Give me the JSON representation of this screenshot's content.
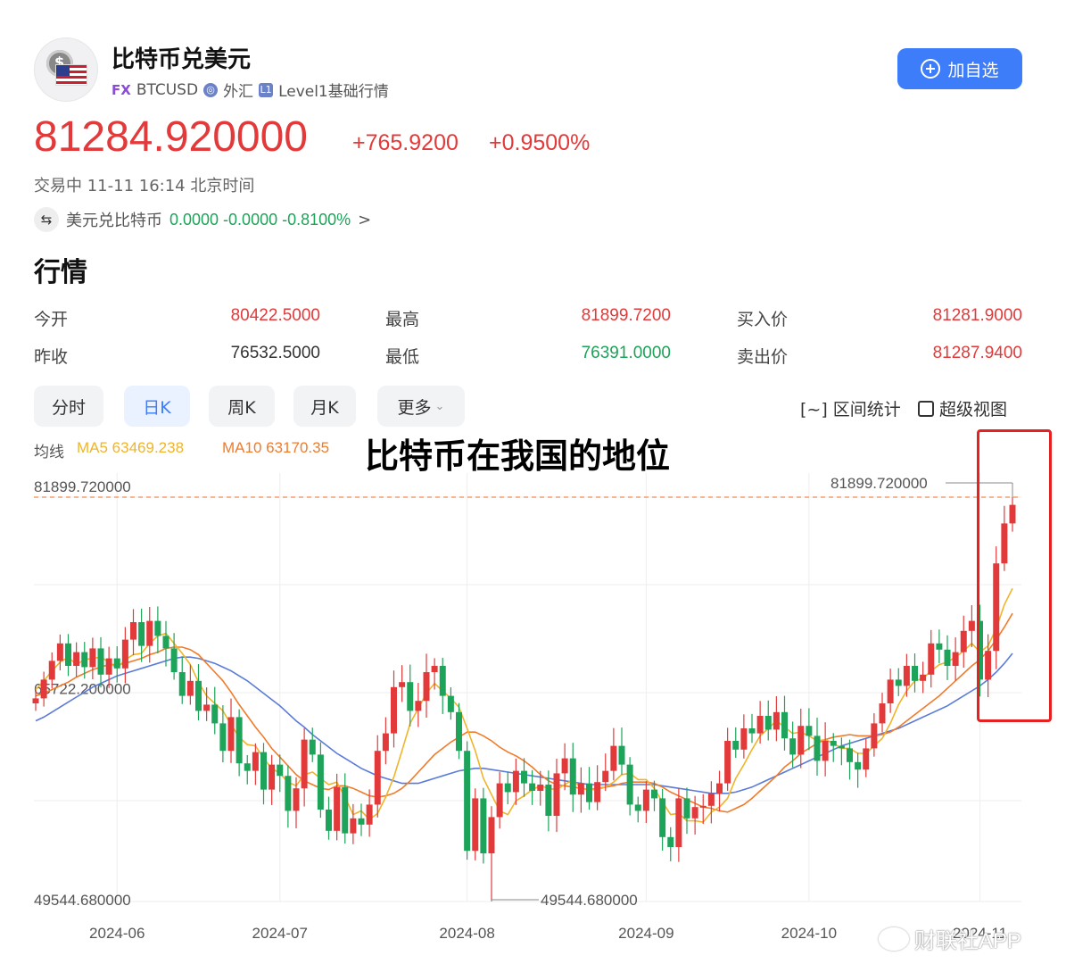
{
  "header": {
    "title": "比特币兑美元",
    "fx_badge": "FX",
    "symbol": "BTCUSD",
    "market": "外汇",
    "level_badge": "L1",
    "level": "Level1基础行情",
    "add_button": "加自选"
  },
  "quote": {
    "price": "81284.920000",
    "change": "+765.9200",
    "change_pct": "+0.9500%",
    "status": "交易中 11-11 16:14 北京时间",
    "inverse_label": "美元兑比特币",
    "inverse_values": "0.0000 -0.0000 -0.8100%",
    "inverse_arrow": ">"
  },
  "section_title": "行情",
  "stats": {
    "open_label": "今开",
    "open": "80422.5000",
    "prev_close_label": "昨收",
    "prev_close": "76532.5000",
    "high_label": "最高",
    "high": "81899.7200",
    "low_label": "最低",
    "low": "76391.0000",
    "bid_label": "买入价",
    "bid": "81281.9000",
    "ask_label": "卖出价",
    "ask": "81287.9400"
  },
  "tabs": [
    "分时",
    "日K",
    "周K",
    "月K",
    "更多"
  ],
  "tools": {
    "range": "[~] 区间统计",
    "super": "超级视图"
  },
  "ma": {
    "label": "均线",
    "ma5": "MA5 63469.238",
    "ma10": "MA10 63170.35"
  },
  "overlay_title": "比特币在我国的地位",
  "watermark": "财联社APP",
  "colors": {
    "up": "#e23a3a",
    "down": "#1ea35a",
    "ma5": "#f0b429",
    "ma10": "#f07b2a",
    "ma20": "#5b7bd9",
    "accent": "#3d7dfa"
  },
  "chart_data": {
    "type": "candlestick",
    "y_labels": [
      "81899.720000",
      "65722.200000",
      "49544.680000"
    ],
    "annotations": {
      "high": "81899.720000",
      "low": "49544.680000"
    },
    "ylim": [
      49544.68,
      81899.72
    ],
    "x_ticks": [
      "2024-06",
      "2024-07",
      "2024-08",
      "2024-09",
      "2024-10",
      "2024-11"
    ],
    "x_tick_index": [
      10,
      30,
      53,
      75,
      95,
      116
    ],
    "close": [
      65800,
      67300,
      68800,
      70200,
      68400,
      69500,
      68300,
      69800,
      67700,
      69000,
      68200,
      70500,
      71900,
      70000,
      72000,
      70800,
      69800,
      67900,
      66000,
      67200,
      64800,
      65300,
      63800,
      61600,
      64300,
      60600,
      60000,
      61500,
      58500,
      60500,
      59600,
      56800,
      58600,
      62500,
      61300,
      56900,
      55200,
      58700,
      55000,
      56200,
      55700,
      57300,
      61600,
      63000,
      66700,
      67100,
      64800,
      65600,
      67900,
      68400,
      66000,
      64700,
      61600,
      53600,
      57800,
      53400,
      56300,
      59000,
      58300,
      60000,
      59000,
      58400,
      58900,
      56400,
      59800,
      61000,
      58100,
      59000,
      57500,
      59100,
      60000,
      62000,
      60500,
      57300,
      56800,
      58500,
      57800,
      54700,
      53900,
      57800,
      56200,
      57100,
      57200,
      58200,
      59000,
      62400,
      61700,
      63400,
      63000,
      64400,
      63300,
      64700,
      62600,
      61300,
      63600,
      62800,
      60800,
      62400,
      62000,
      61800,
      60700,
      60100,
      61800,
      63800,
      65400,
      67300,
      66800,
      68400,
      67200,
      67700,
      70200,
      69700,
      68400,
      69500,
      71200,
      72000,
      67300,
      69600,
      76600,
      79800,
      81285
    ],
    "ma5": [
      66500,
      67200,
      68000,
      68700,
      69100,
      68500,
      68900,
      69000,
      69100,
      68700,
      68200,
      68900,
      69300,
      69400,
      70200,
      70800,
      71000,
      70200,
      69400,
      68500,
      67100,
      66000,
      65400,
      64800,
      63700,
      62700,
      62100,
      62000,
      61000,
      60200,
      59800,
      59100,
      58800,
      59700,
      59900,
      59400,
      58900,
      59100,
      57900,
      56500,
      56800,
      56100,
      56600,
      57900,
      59500,
      61600,
      63800,
      65000,
      66200,
      67000,
      66400,
      65800,
      65100,
      63400,
      61600,
      59400,
      58100,
      56800,
      56500,
      57600,
      58000,
      58500,
      58800,
      58600,
      58500,
      58900,
      59300,
      58600,
      58500,
      58500,
      58700,
      59100,
      59700,
      59800,
      59300,
      59300,
      58600,
      57500,
      56500,
      56600,
      56000,
      56000,
      55900,
      56700,
      57100,
      57800,
      59400,
      60500,
      61700,
      62800,
      63400,
      64000,
      63500,
      63000,
      63100,
      62800,
      62400,
      62500,
      62200,
      61800,
      61800,
      61400,
      61400,
      62000,
      62600,
      63800,
      65300,
      66400,
      67200,
      67400,
      68000,
      68500,
      68700,
      69100,
      69600,
      70200,
      69500,
      70000,
      71400,
      73300,
      74600
    ],
    "ma10": [
      66000,
      66200,
      66500,
      66800,
      67100,
      67500,
      67800,
      68100,
      68300,
      68500,
      68500,
      68600,
      68800,
      69000,
      69300,
      69500,
      69800,
      69900,
      69900,
      69700,
      69300,
      68600,
      67900,
      67200,
      66300,
      65300,
      64400,
      63500,
      62700,
      61800,
      61100,
      60400,
      59700,
      59200,
      58900,
      58600,
      58500,
      58800,
      58800,
      58600,
      58300,
      58000,
      57900,
      58000,
      58200,
      58600,
      59200,
      59900,
      60600,
      61300,
      61800,
      62300,
      62700,
      63100,
      63100,
      62800,
      62400,
      61900,
      61500,
      61200,
      60800,
      60300,
      59700,
      59200,
      58900,
      58800,
      58700,
      58600,
      58500,
      58600,
      58700,
      58800,
      59000,
      59100,
      59100,
      59100,
      59000,
      58700,
      58300,
      58000,
      57700,
      57400,
      57100,
      57000,
      56800,
      56700,
      57000,
      57300,
      57800,
      58400,
      59000,
      59600,
      60300,
      60800,
      61400,
      61800,
      62200,
      62500,
      62700,
      62800,
      62900,
      62800,
      62800,
      62800,
      62900,
      63100,
      63500,
      64000,
      64500,
      65000,
      65500,
      66000,
      66600,
      67200,
      67800,
      68400,
      68900,
      69600,
      70500,
      71500,
      72600
    ],
    "ma20": [
      64000,
      64300,
      64700,
      65100,
      65500,
      65900,
      66300,
      66700,
      67000,
      67300,
      67600,
      67800,
      68000,
      68200,
      68400,
      68600,
      68800,
      69000,
      69100,
      69100,
      69000,
      68800,
      68600,
      68300,
      68000,
      67600,
      67200,
      66700,
      66200,
      65700,
      65200,
      64600,
      64000,
      63500,
      62900,
      62400,
      61900,
      61400,
      61000,
      60600,
      60200,
      59900,
      59600,
      59400,
      59200,
      59000,
      59000,
      59000,
      59200,
      59400,
      59600,
      59800,
      60000,
      60100,
      60200,
      60200,
      60100,
      60000,
      59900,
      59800,
      59700,
      59600,
      59500,
      59400,
      59300,
      59200,
      59100,
      59000,
      58900,
      58900,
      58900,
      58900,
      58900,
      58900,
      58900,
      58900,
      58900,
      58800,
      58700,
      58600,
      58500,
      58400,
      58300,
      58200,
      58200,
      58200,
      58300,
      58500,
      58700,
      59000,
      59300,
      59600,
      59900,
      60200,
      60500,
      60800,
      61100,
      61400,
      61700,
      62000,
      62200,
      62400,
      62600,
      62800,
      63000,
      63200,
      63400,
      63700,
      64000,
      64300,
      64600,
      64900,
      65200,
      65600,
      66000,
      66400,
      66800,
      67300,
      67900,
      68600,
      69400
    ]
  }
}
